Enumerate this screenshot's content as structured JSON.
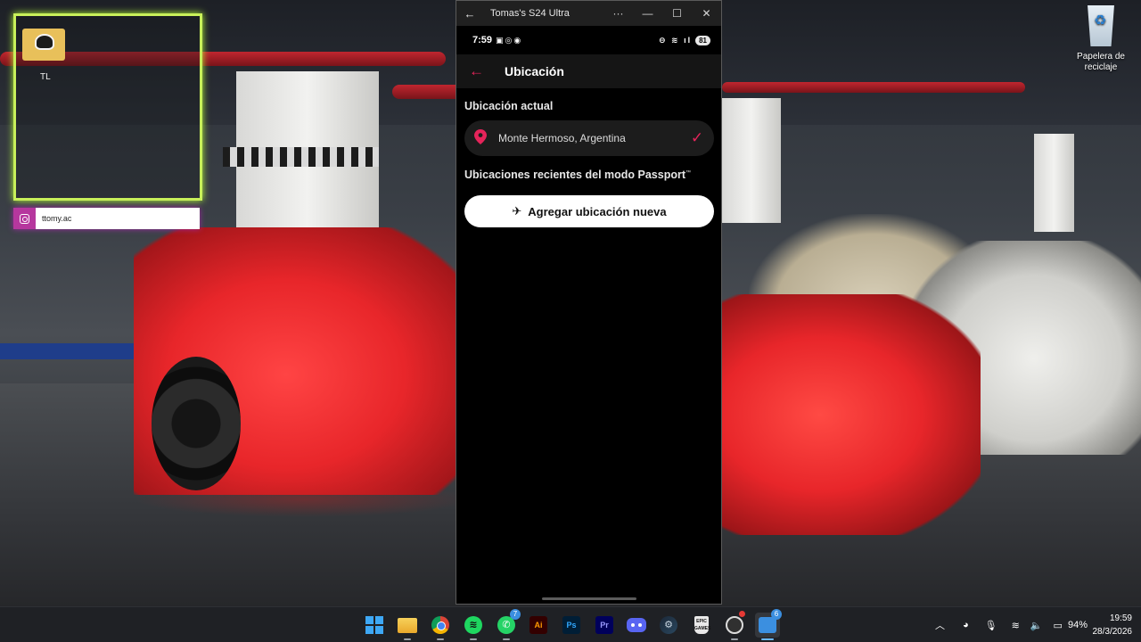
{
  "overlay": {
    "cam_label": "TL",
    "social_handle": "ttomy.ac"
  },
  "desktop": {
    "recycle_bin_label": "Papelera de reciclaje"
  },
  "window": {
    "title": "Tomas's S24 Ultra",
    "back_glyph": "←",
    "more_glyph": "···",
    "minimize_glyph": "—",
    "maximize_glyph": "☐",
    "close_glyph": "✕"
  },
  "phone": {
    "status": {
      "time": "7:59",
      "battery": "81"
    },
    "header": {
      "back_glyph": "←",
      "title": "Ubicación"
    },
    "current_section_label": "Ubicación actual",
    "current_location": "Monte Hermoso, Argentina",
    "recent_section_label": "Ubicaciones recientes del modo Passport",
    "recent_section_mark": "™",
    "add_button_label": "Agregar ubicación nueva",
    "accent_color": "#e5245a"
  },
  "taskbar": {
    "apps": [
      {
        "name": "Inicio",
        "icon": "windows-start-icon"
      },
      {
        "name": "Explorador de archivos",
        "icon": "file-explorer-icon"
      },
      {
        "name": "Google Chrome",
        "icon": "chrome-icon"
      },
      {
        "name": "Spotify",
        "icon": "spotify-icon"
      },
      {
        "name": "WhatsApp",
        "icon": "whatsapp-icon",
        "badge": "7"
      },
      {
        "name": "Adobe Illustrator",
        "icon": "illustrator-icon",
        "short": "Ai"
      },
      {
        "name": "Adobe Photoshop",
        "icon": "photoshop-icon",
        "short": "Ps"
      },
      {
        "name": "Adobe Premiere Pro",
        "icon": "premiere-icon",
        "short": "Pr"
      },
      {
        "name": "Discord",
        "icon": "discord-icon"
      },
      {
        "name": "Steam",
        "icon": "steam-icon"
      },
      {
        "name": "Epic Games",
        "icon": "epic-games-icon",
        "short": "EPIC GAMES"
      },
      {
        "name": "OBS Studio",
        "icon": "obs-icon"
      },
      {
        "name": "Vínculo Móvil",
        "icon": "phone-link-icon",
        "badge": "6"
      }
    ],
    "tray": {
      "battery_percent": "94%",
      "time": "19:59",
      "date": "28/3/2026"
    }
  }
}
